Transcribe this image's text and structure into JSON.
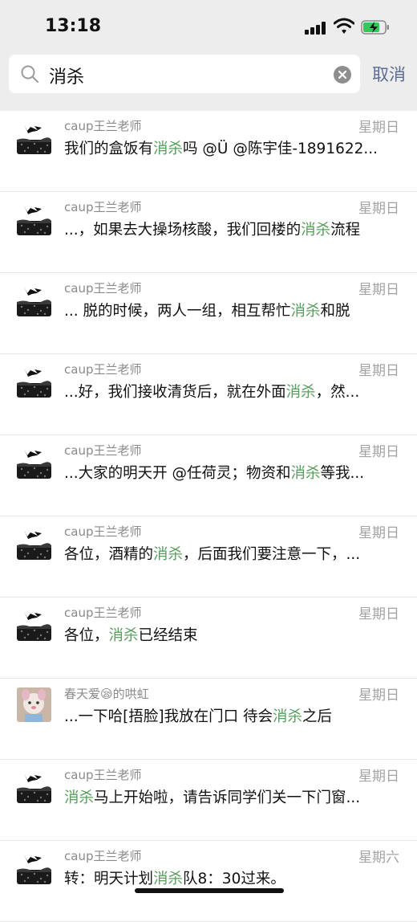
{
  "status": {
    "time": "13:18"
  },
  "search": {
    "query": "消杀",
    "cancel_label": "取消"
  },
  "results": [
    {
      "sender": "caup王兰老师",
      "date": "星期日",
      "avatar": "ink-logo",
      "before": "我们的盒饭有",
      "keyword": "消杀",
      "after": "吗 @Ü @陈宇佳-1891622..."
    },
    {
      "sender": "caup王兰老师",
      "date": "星期日",
      "avatar": "ink-logo",
      "before": "...，如果去大操场核酸，我们回楼的",
      "keyword": "消杀",
      "after": "流程"
    },
    {
      "sender": "caup王兰老师",
      "date": "星期日",
      "avatar": "ink-logo",
      "before": "... 脱的时候，两人一组，相互帮忙",
      "keyword": "消杀",
      "after": "和脱"
    },
    {
      "sender": "caup王兰老师",
      "date": "星期日",
      "avatar": "ink-logo",
      "before": "...好，我们接收清货后，就在外面",
      "keyword": "消杀",
      "after": "，然..."
    },
    {
      "sender": "caup王兰老师",
      "date": "星期日",
      "avatar": "ink-logo",
      "before": "...大家的明天开 @任荷灵；物资和",
      "keyword": "消杀",
      "after": "等我..."
    },
    {
      "sender": "caup王兰老师",
      "date": "星期日",
      "avatar": "ink-logo",
      "before": "各位，酒精的",
      "keyword": "消杀",
      "after": "，后面我们要注意一下，..."
    },
    {
      "sender": "caup王兰老师",
      "date": "星期日",
      "avatar": "ink-logo",
      "before": "各位，",
      "keyword": "消杀",
      "after": "已经结束"
    },
    {
      "sender": "春天爱😪的哄虹",
      "date": "星期日",
      "avatar": "cartoon-photo",
      "before": "...一下哈[捂脸]我放在门口 待会",
      "keyword": "消杀",
      "after": "之后"
    },
    {
      "sender": "caup王兰老师",
      "date": "星期日",
      "avatar": "ink-logo",
      "before": "",
      "keyword": "消杀",
      "after": "马上开始啦，请告诉同学们关一下门窗..."
    },
    {
      "sender": "caup王兰老师",
      "date": "星期六",
      "avatar": "ink-logo",
      "before": "转：明天计划",
      "keyword": "消杀",
      "after": "队8：30过来。"
    }
  ],
  "colors": {
    "highlight": "#57a05c",
    "header_bg": "#ededed",
    "cancel": "#5b6b94"
  }
}
